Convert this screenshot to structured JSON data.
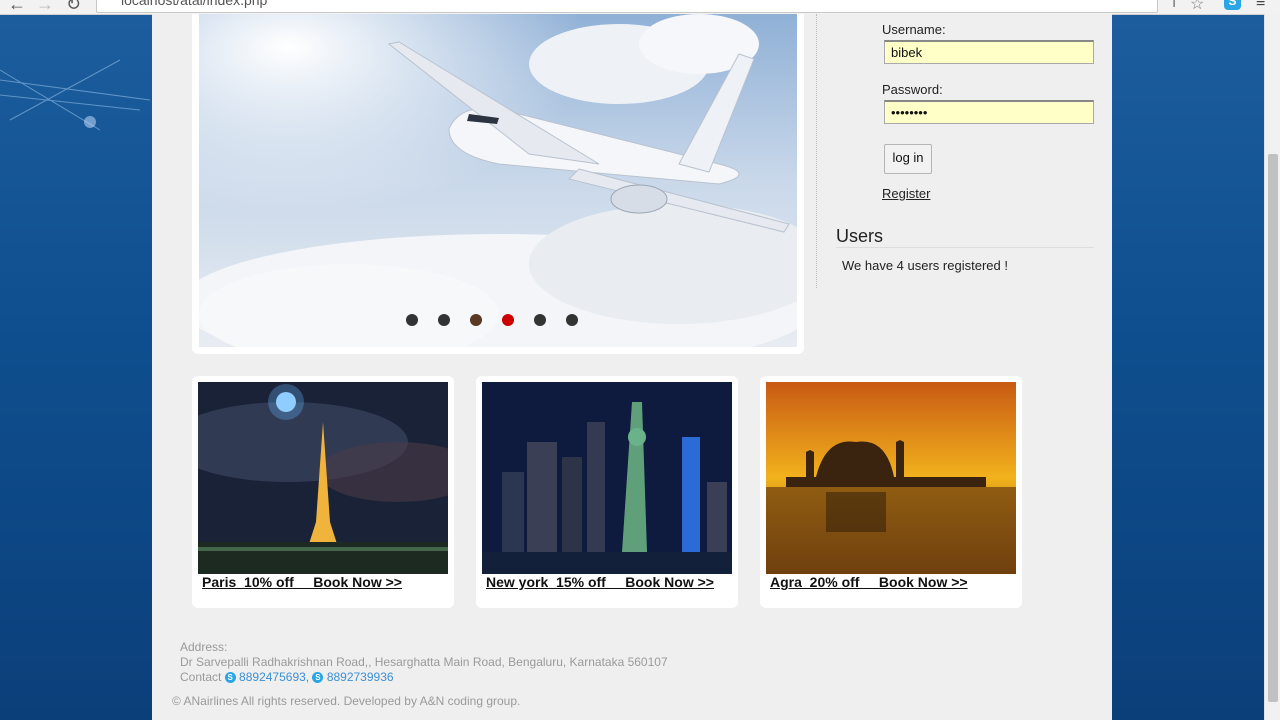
{
  "browser": {
    "url": "localhost/atal/index.php"
  },
  "slider": {
    "active_dot": 4,
    "dot_count": 6,
    "dot_colors": [
      "#333333",
      "#333333",
      "#5a3a22",
      "#cc0000",
      "#333333",
      "#333333"
    ]
  },
  "login": {
    "username_label": "Username:",
    "username_value": "bibek",
    "password_label": "Password:",
    "password_value": "••••••••",
    "login_button": "log in",
    "register_link": "Register"
  },
  "users": {
    "title": "Users",
    "text": "We have 4 users registered !"
  },
  "offers": [
    {
      "caption": "Paris  10% off     Book Now >>"
    },
    {
      "caption": "New york  15% off     Book Now >>"
    },
    {
      "caption": "Agra  20% off     Book Now >>"
    }
  ],
  "footer": {
    "address_label": "Address:",
    "address": "Dr Sarvepalli Radhakrishnan Road,, Hesarghatta Main Road, Bengaluru, Karnataka 560107",
    "contact_label": "Contact",
    "phone1": "8892475693,",
    "phone2": "8892739936",
    "copyright": "© ANairlines All rights reserved. Developed by A&N coding group."
  },
  "colors": {
    "field_bg": "#ffffc8",
    "active_dot": "#cc0000",
    "link_blue": "#3b8fd6"
  }
}
